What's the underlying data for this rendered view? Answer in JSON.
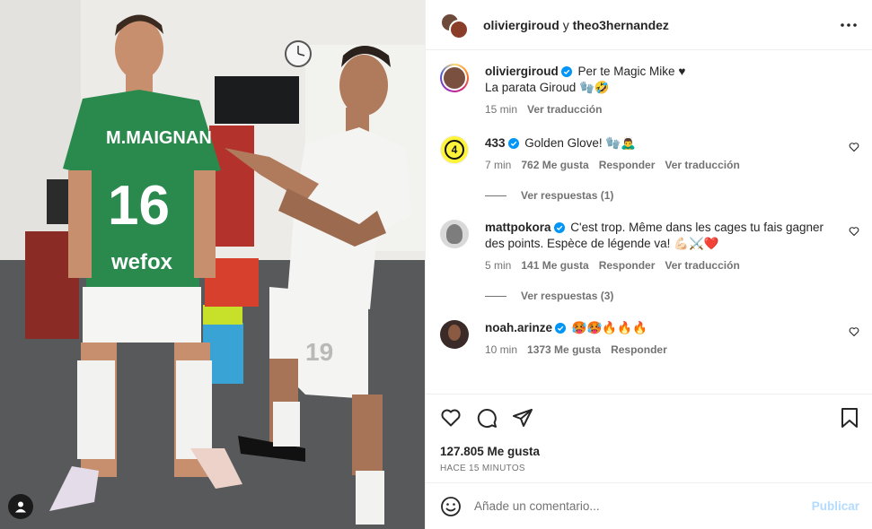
{
  "header": {
    "user1": "oliviergiroud",
    "conj": "y",
    "user2": "theo3hernandez"
  },
  "caption": {
    "user": "oliviergiroud",
    "line1": "Per te Magic Mike ♥",
    "line2": "La parata Giroud 🧤🤣",
    "time": "15 min",
    "translate": "Ver traducción"
  },
  "comments": [
    {
      "user": "433",
      "text": "Golden Glove! 🧤🙇‍♂️",
      "time": "7 min",
      "likes": "762 Me gusta",
      "reply": "Responder",
      "translate": "Ver traducción",
      "replies": "Ver respuestas (1)"
    },
    {
      "user": "mattpokora",
      "text": "C'est trop. Même dans les cages tu fais gagner des points. Espèce de légende va! 💪🏻⚔️❤️",
      "time": "5 min",
      "likes": "141 Me gusta",
      "reply": "Responder",
      "translate": "Ver traducción",
      "replies": "Ver respuestas (3)"
    },
    {
      "user": "noah.arinze",
      "text": "🥵🥵🔥🔥🔥",
      "time": "10 min",
      "likes": "1373 Me gusta",
      "reply": "Responder"
    }
  ],
  "post": {
    "likes": "127.805 Me gusta",
    "ago": "HACE 15 MINUTOS"
  },
  "composer": {
    "placeholder": "Añade un comentario...",
    "publish": "Publicar"
  },
  "photo": {
    "jersey_name": "M.MAIGNAN",
    "jersey_number": "16",
    "sponsor": "wefox",
    "shorts_number": "19"
  },
  "colors": {
    "verified": "#0095f6",
    "link_muted": "#737373",
    "publish_disabled": "#b3dbff",
    "jersey_green": "#2a8a4e"
  },
  "icons": {
    "more": "more-icon",
    "like": "heart-icon",
    "comment": "comment-icon",
    "share": "share-icon",
    "save": "bookmark-icon",
    "emoji": "emoji-icon",
    "tag": "user-tag-icon"
  }
}
